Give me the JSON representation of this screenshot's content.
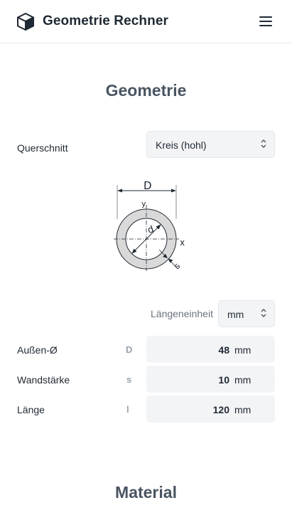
{
  "header": {
    "title": "Geometrie Rechner",
    "logo_icon": "cube-icon",
    "menu_icon": "hamburger-menu-icon"
  },
  "geometry": {
    "section_title": "Geometrie",
    "cross_section": {
      "label": "Querschnitt",
      "selected": "Kreis (hohl)"
    },
    "diagram": {
      "dim_outer": "D",
      "dim_inner": "d",
      "dim_wall": "s",
      "axis_x": "x",
      "axis_y": "y"
    },
    "length_unit": {
      "label": "Längeneinheit",
      "selected": "mm"
    },
    "fields": [
      {
        "label": "Außen-Ø",
        "symbol": "D",
        "value": "48",
        "unit": "mm"
      },
      {
        "label": "Wandstärke",
        "symbol": "s",
        "value": "10",
        "unit": "mm"
      },
      {
        "label": "Länge",
        "symbol": "l",
        "value": "120",
        "unit": "mm"
      }
    ]
  },
  "material": {
    "section_title": "Material"
  },
  "colors": {
    "accent_text": "#1f2933",
    "section_title": "#4a5562",
    "input_bg": "#f3f4f6",
    "diagram_fill": "#d9d9d9"
  }
}
